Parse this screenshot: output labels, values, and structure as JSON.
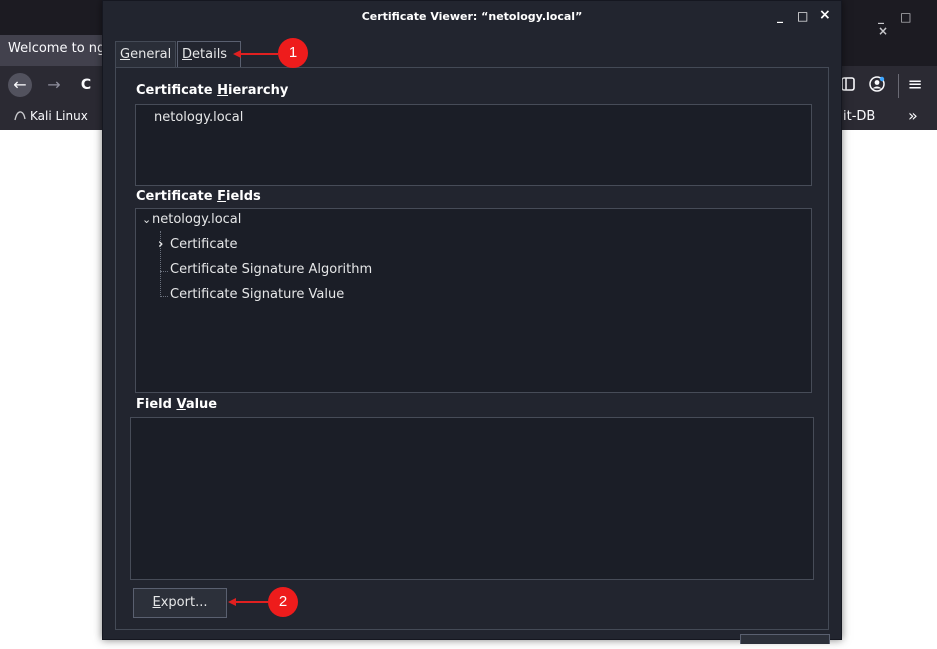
{
  "browser": {
    "tab_title": "Welcome to ng",
    "window_controls": "_ □ ×",
    "back_icon": "←",
    "forward_icon": "→",
    "reload_icon": "C",
    "bookmarks": {
      "left_label": "Kali Linux",
      "right_label": "it-DB",
      "overflow_icon": "»"
    },
    "menu_icon": "≡"
  },
  "dialog": {
    "title": "Certificate Viewer: “netology.local”",
    "controls": {
      "minimize": "_",
      "maximize": "□",
      "close": "×"
    },
    "tabs": [
      {
        "pre": "",
        "ul": "G",
        "post": "eneral",
        "active": false
      },
      {
        "pre": "",
        "ul": "D",
        "post": "etails",
        "active": true
      }
    ],
    "hierarchy": {
      "label_pre": "Certificate ",
      "label_ul": "H",
      "label_post": "ierarchy",
      "items": [
        "netology.local"
      ]
    },
    "fields": {
      "label_pre": "Certificate ",
      "label_ul": "F",
      "label_post": "ields",
      "root": "netology.local",
      "root_icon": "⌄",
      "children": [
        {
          "label": "Certificate",
          "expander": "›"
        },
        {
          "label": "Certificate Signature Algorithm",
          "expander": ""
        },
        {
          "label": "Certificate Signature Value",
          "expander": ""
        }
      ]
    },
    "field_value": {
      "label_pre": "Field ",
      "label_ul": "V",
      "label_post": "alue",
      "value": ""
    },
    "export_button": {
      "ul": "E",
      "post": "xport..."
    }
  },
  "annotations": [
    {
      "number": "1",
      "color": "#ee1c1c"
    },
    {
      "number": "2",
      "color": "#ee1c1c"
    }
  ]
}
